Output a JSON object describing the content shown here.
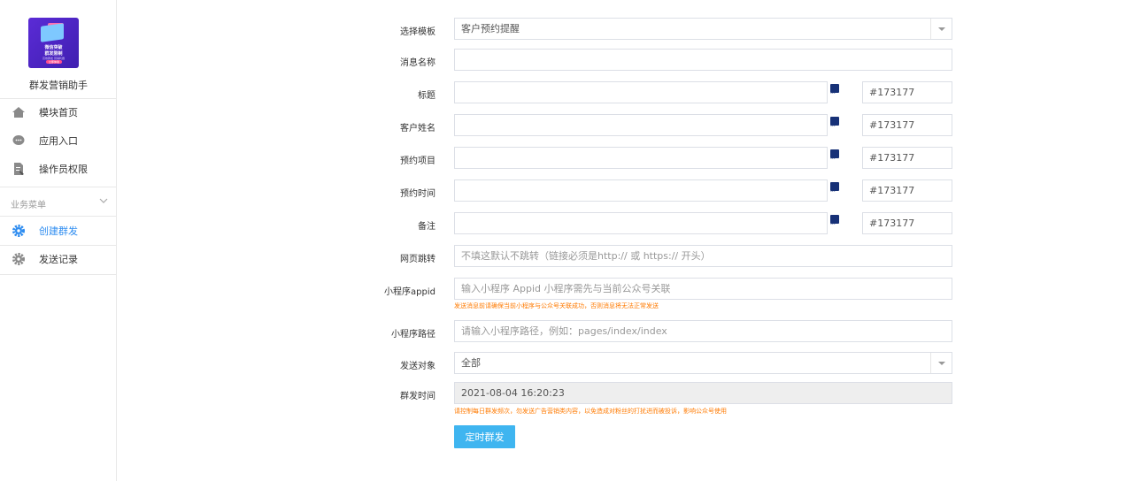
{
  "app": {
    "name": "群发营销助手",
    "logo_line1": "微信突破",
    "logo_line2": "群发限制",
    "logo_line3": "高效群发 营销利器",
    "logo_badge": "立即体验"
  },
  "sidebar": {
    "items": [
      {
        "label": "模块首页",
        "icon": "home-icon"
      },
      {
        "label": "应用入口",
        "icon": "chat-icon"
      },
      {
        "label": "操作员权限",
        "icon": "doc-edit-icon"
      }
    ],
    "section_label": "业务菜单",
    "business_items": [
      {
        "label": "创建群发",
        "icon": "gear-icon",
        "active": true
      },
      {
        "label": "发送记录",
        "icon": "gear-icon",
        "active": false
      }
    ]
  },
  "form": {
    "template": {
      "label": "选择模板",
      "value": "客户预约提醒"
    },
    "message_name": {
      "label": "消息名称",
      "value": ""
    },
    "title": {
      "label": "标题",
      "value": "",
      "color": "#173177"
    },
    "customer_name": {
      "label": "客户姓名",
      "value": "",
      "color": "#173177"
    },
    "booking_item": {
      "label": "预约项目",
      "value": "",
      "color": "#173177"
    },
    "booking_time": {
      "label": "预约时间",
      "value": "",
      "color": "#173177"
    },
    "remark": {
      "label": "备注",
      "value": "",
      "color": "#173177"
    },
    "web_jump": {
      "label": "网页跳转",
      "placeholder": "不填这默认不跳转（链接必须是http:// 或 https:// 开头）"
    },
    "mini_appid": {
      "label": "小程序appid",
      "placeholder": "输入小程序 Appid 小程序需先与当前公众号关联",
      "hint": "发送消息前请确保当前小程序与公众号关联成功，否则消息将无法正常发送"
    },
    "mini_path": {
      "label": "小程序路径",
      "placeholder": "请输入小程序路径，例如：pages/index/index"
    },
    "target": {
      "label": "发送对象",
      "value": "全部"
    },
    "send_time": {
      "label": "群发时间",
      "value": "2021-08-04 16:20:23",
      "hint": "请控制每日群发频次，勿发送广告营销类内容，以免造成对粉丝的打扰进而被投诉，影响公众号使用"
    },
    "submit_label": "定时群发"
  }
}
